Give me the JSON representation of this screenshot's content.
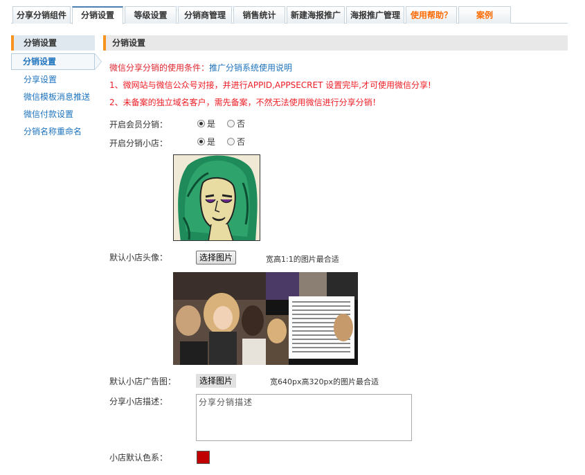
{
  "tabs": [
    {
      "label": "分享分销组件",
      "active": false
    },
    {
      "label": "分销设置",
      "active": true
    },
    {
      "label": "等级设置",
      "active": false
    },
    {
      "label": "分销商管理",
      "active": false
    },
    {
      "label": "销售统计",
      "active": false
    },
    {
      "label": "新建海报推广",
      "active": false
    },
    {
      "label": "海报推广管理",
      "active": false
    },
    {
      "label": "使用帮助？",
      "active": false
    },
    {
      "label": "案例",
      "active": false
    }
  ],
  "sidebar": {
    "header": "分销设置",
    "active_item": "分销设置",
    "items": [
      "分享设置",
      "微信模板消息推送",
      "微信付款设置",
      "分销名称重命名"
    ]
  },
  "main": {
    "title": "分销设置",
    "notice": {
      "prefix": "微信分享分销的使用条件：",
      "link": "推广分销系统使用说明",
      "line1": "1、微网站与微信公众号对接，并进行APPID,APPSECRET 设置完毕,才可使用微信分享!",
      "line2": "2、未备案的独立域名客户，需先备案，不然无法使用微信进行分享分销！"
    },
    "member_distribution": {
      "label": "开启会员分销：",
      "options": [
        "是",
        "否"
      ],
      "selected": "是"
    },
    "shop_distribution": {
      "label": "开启分销小店：",
      "options": [
        "是",
        "否"
      ],
      "selected": "是"
    },
    "avatar": {
      "label": "默认小店头像：",
      "button": "选择图片",
      "hint": "宽高1:1的图片最合适"
    },
    "banner": {
      "label": "默认小店广告图：",
      "button": "选择图片",
      "hint": "宽640px高320px的图片最合适"
    },
    "description": {
      "label": "分享小店描述：",
      "value": "分享分销描述"
    },
    "color": {
      "label": "小店默认色系：",
      "value": "#c00000"
    }
  }
}
